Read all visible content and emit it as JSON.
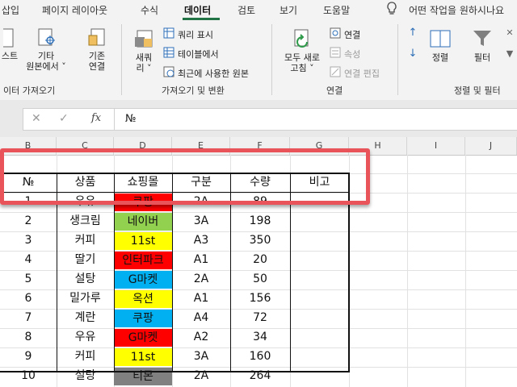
{
  "tabs": [
    "삽입",
    "페이지 레이아웃",
    "수식",
    "데이터",
    "검토",
    "보기",
    "도움말"
  ],
  "tell_me": "어떤 작업을 원하시나요",
  "ribbon": {
    "partial_text": "스트",
    "other_sources": [
      "기타",
      "원본에서"
    ],
    "existing_connections": [
      "기존",
      "연결"
    ],
    "new_query": [
      "새쿼",
      "리"
    ],
    "show_queries": "쿼리 표시",
    "from_table": "테이블에서",
    "recent_sources": "최근에 사용한 원본",
    "refresh_all": [
      "모두 새로",
      "고침"
    ],
    "connections": "연결",
    "properties": "속성",
    "edit_links": "연결 편집",
    "sort": "정렬",
    "filter": "필터",
    "group_get_data": "이터 가져오기",
    "group_get_transform": "가져오기 및 변환",
    "group_connections": "연결",
    "group_sort_filter": "정렬 및 필터"
  },
  "formula_bar": {
    "fx": "fx",
    "value": "№"
  },
  "columns": [
    "B",
    "C",
    "D",
    "E",
    "F",
    "G",
    "H",
    "I",
    "J"
  ],
  "table": {
    "headers": [
      "№",
      "상품",
      "쇼핑몰",
      "구분",
      "수량",
      "비고"
    ],
    "rows": [
      {
        "no": "1",
        "product": "우유",
        "mall": "쿠팡",
        "type": "2A",
        "qty": "89",
        "color": "#ff0000"
      },
      {
        "no": "2",
        "product": "생크림",
        "mall": "네이버",
        "type": "3A",
        "qty": "198",
        "color": "#92d050"
      },
      {
        "no": "3",
        "product": "커피",
        "mall": "11st",
        "type": "A3",
        "qty": "350",
        "color": "#ffff00"
      },
      {
        "no": "4",
        "product": "딸기",
        "mall": "인터파크",
        "type": "A1",
        "qty": "20",
        "color": "#ff0000"
      },
      {
        "no": "5",
        "product": "설탕",
        "mall": "G마켓",
        "type": "2A",
        "qty": "50",
        "color": "#00b0f0"
      },
      {
        "no": "6",
        "product": "밀가루",
        "mall": "옥션",
        "type": "A1",
        "qty": "156",
        "color": "#ffff00"
      },
      {
        "no": "7",
        "product": "계란",
        "mall": "쿠팡",
        "type": "A4",
        "qty": "72",
        "color": "#00b0f0"
      },
      {
        "no": "8",
        "product": "우유",
        "mall": "G마켓",
        "type": "A2",
        "qty": "34",
        "color": "#ff0000"
      },
      {
        "no": "9",
        "product": "커피",
        "mall": "11st",
        "type": "3A",
        "qty": "160",
        "color": "#ffff00"
      },
      {
        "no": "10",
        "product": "설탕",
        "mall": "티몬",
        "type": "2A",
        "qty": "264",
        "color": "#808080"
      }
    ]
  },
  "colors": {
    "accent": "#217346",
    "highlight": "#e8545a"
  }
}
